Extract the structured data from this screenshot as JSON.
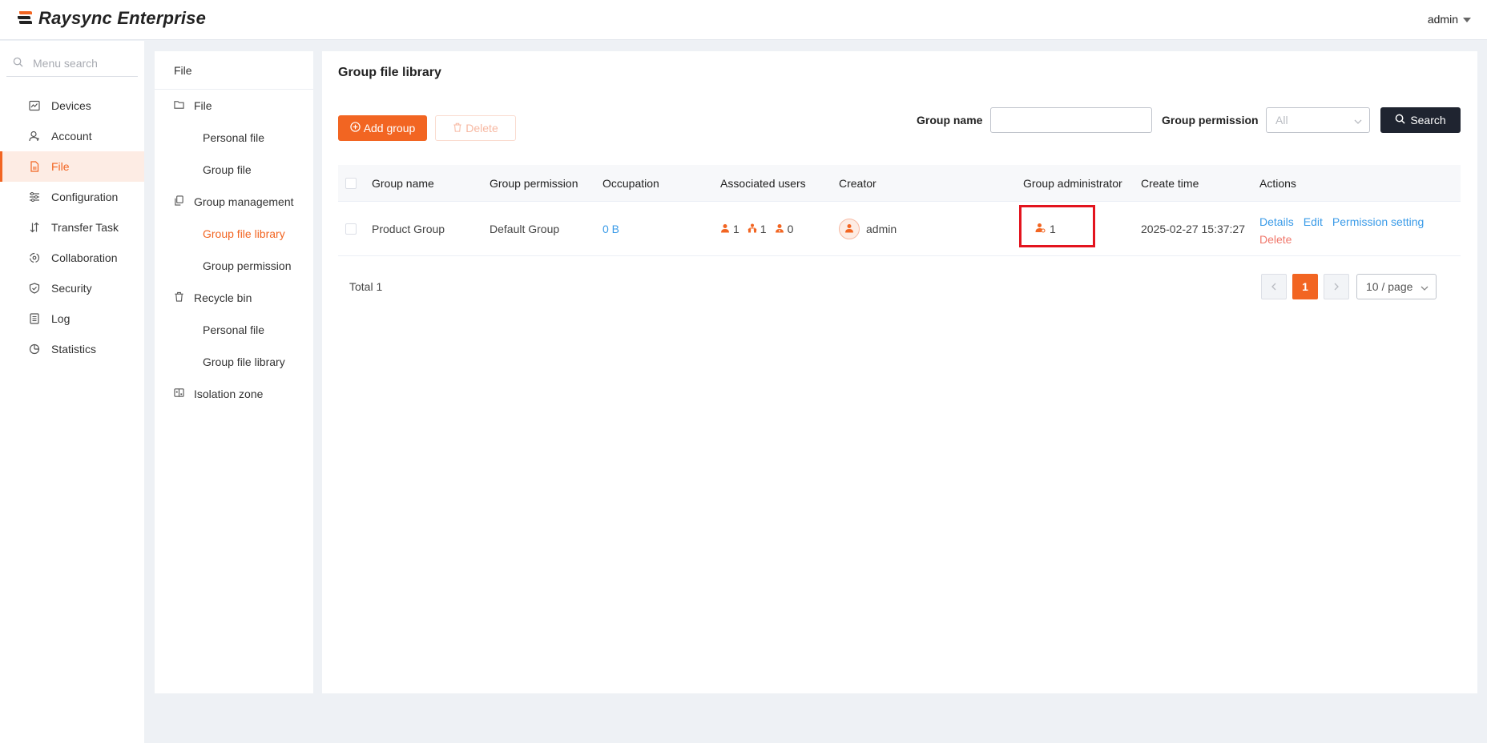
{
  "app": {
    "title": "Raysync Enterprise",
    "user": "admin"
  },
  "sidebar": {
    "search_placeholder": "Menu search",
    "items": [
      {
        "label": "Devices",
        "icon": "devices-icon"
      },
      {
        "label": "Account",
        "icon": "account-icon"
      },
      {
        "label": "File",
        "icon": "file-icon",
        "active": true
      },
      {
        "label": "Configuration",
        "icon": "sliders-icon"
      },
      {
        "label": "Transfer Task",
        "icon": "transfer-icon"
      },
      {
        "label": "Collaboration",
        "icon": "collaboration-icon"
      },
      {
        "label": "Security",
        "icon": "shield-icon"
      },
      {
        "label": "Log",
        "icon": "log-icon"
      },
      {
        "label": "Statistics",
        "icon": "pie-chart-icon"
      }
    ]
  },
  "subnav": {
    "title": "File",
    "groups": [
      {
        "label": "File",
        "children": [
          "Personal file",
          "Group file"
        ]
      },
      {
        "label": "Group management",
        "children": [
          "Group file library",
          "Group permission"
        ]
      },
      {
        "label": "Recycle bin",
        "children": [
          "Personal file",
          "Group file library"
        ]
      },
      {
        "label": "Isolation zone",
        "children": []
      }
    ],
    "active": "Group file library"
  },
  "main": {
    "title": "Group file library",
    "add_label": "Add group",
    "delete_label": "Delete",
    "filter_name_label": "Group name",
    "filter_name_value": "",
    "filter_perm_label": "Group permission",
    "filter_perm_value": "All",
    "search_label": "Search"
  },
  "table": {
    "columns": [
      "Group name",
      "Group permission",
      "Occupation",
      "Associated users",
      "Creator",
      "Group administrator",
      "Create time",
      "Actions"
    ],
    "rows": [
      {
        "group_name": "Product Group",
        "permission": "Default Group",
        "occupation": "0 B",
        "assoc_users": "1",
        "assoc_departments": "1",
        "assoc_groups": "0",
        "creator": "admin",
        "admin_count": "1",
        "create_time": "2025-02-27 15:37:27",
        "actions": {
          "details": "Details",
          "edit": "Edit",
          "permission": "Permission setting",
          "delete": "Delete"
        }
      }
    ]
  },
  "pagination": {
    "total": "Total 1",
    "current": "1",
    "page_size": "10 / page"
  },
  "colors": {
    "accent": "#f26522",
    "link": "#3a9be8",
    "dark_button": "#1f2430",
    "highlight": "#e3141e"
  }
}
